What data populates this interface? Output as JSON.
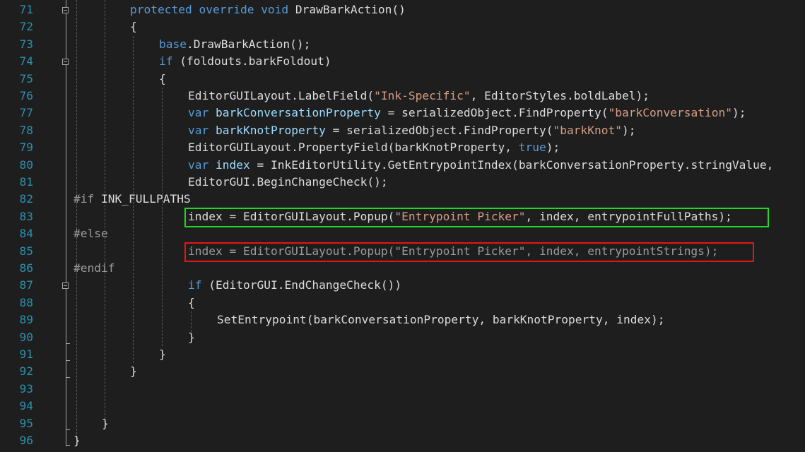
{
  "editor": {
    "line_numbers": [
      "71",
      "72",
      "73",
      "74",
      "75",
      "76",
      "77",
      "78",
      "79",
      "80",
      "81",
      "82",
      "83",
      "84",
      "85",
      "86",
      "87",
      "88",
      "89",
      "90",
      "91",
      "92",
      "93",
      "94",
      "95",
      "96"
    ],
    "lines": [
      {
        "indent": 80,
        "tokens": [
          {
            "t": "protected",
            "c": "kw"
          },
          {
            "t": " "
          },
          {
            "t": "override",
            "c": "kw"
          },
          {
            "t": " "
          },
          {
            "t": "void",
            "c": "kw"
          },
          {
            "t": " DrawBarkAction()"
          }
        ]
      },
      {
        "indent": 80,
        "tokens": [
          {
            "t": "{"
          }
        ]
      },
      {
        "indent": 121,
        "tokens": [
          {
            "t": "base",
            "c": "kw"
          },
          {
            "t": ".DrawBarkAction();"
          }
        ]
      },
      {
        "indent": 121,
        "tokens": [
          {
            "t": "if",
            "c": "kw"
          },
          {
            "t": " (foldouts.barkFoldout)"
          }
        ]
      },
      {
        "indent": 121,
        "tokens": [
          {
            "t": "{"
          }
        ]
      },
      {
        "indent": 162,
        "tokens": [
          {
            "t": "EditorGUILayout.LabelField("
          },
          {
            "t": "\"Ink-Specific\"",
            "c": "str"
          },
          {
            "t": ", EditorStyles.boldLabel);"
          }
        ]
      },
      {
        "indent": 162,
        "tokens": [
          {
            "t": "var",
            "c": "kw"
          },
          {
            "t": " "
          },
          {
            "t": "barkConversationProperty",
            "c": "var"
          },
          {
            "t": " = serializedObject.FindProperty("
          },
          {
            "t": "\"barkConversation\"",
            "c": "str"
          },
          {
            "t": ");"
          }
        ]
      },
      {
        "indent": 162,
        "tokens": [
          {
            "t": "var",
            "c": "kw"
          },
          {
            "t": " "
          },
          {
            "t": "barkKnotProperty",
            "c": "var"
          },
          {
            "t": " = serializedObject.FindProperty("
          },
          {
            "t": "\"barkKnot\"",
            "c": "str"
          },
          {
            "t": ");"
          }
        ]
      },
      {
        "indent": 162,
        "tokens": [
          {
            "t": "EditorGUILayout.PropertyField(barkKnotProperty, "
          },
          {
            "t": "true",
            "c": "kw"
          },
          {
            "t": ");"
          }
        ]
      },
      {
        "indent": 162,
        "tokens": [
          {
            "t": "var",
            "c": "kw"
          },
          {
            "t": " "
          },
          {
            "t": "index",
            "c": "var"
          },
          {
            "t": " = InkEditorUtility.GetEntrypointIndex(barkConversationProperty.stringValue,"
          }
        ]
      },
      {
        "indent": 162,
        "tokens": [
          {
            "t": "EditorGUI.BeginChangeCheck();"
          }
        ]
      },
      {
        "indent": 0,
        "tokens": [
          {
            "t": "#if",
            "c": "pp"
          },
          {
            "t": " INK_FULLPATHS"
          }
        ]
      },
      {
        "indent": 162,
        "tokens": [
          {
            "t": "index = EditorGUILayout.Popup("
          },
          {
            "t": "\"Entrypoint Picker\"",
            "c": "str"
          },
          {
            "t": ", index, entrypointFullPaths);"
          }
        ]
      },
      {
        "indent": 0,
        "tokens": [
          {
            "t": "#else",
            "c": "pp"
          }
        ]
      },
      {
        "indent": 162,
        "tokens": [
          {
            "t": "index = EditorGUILayout.Popup(\"Entrypoint Picker\", index, entrypointStrings);",
            "c": "dim"
          }
        ]
      },
      {
        "indent": 0,
        "tokens": [
          {
            "t": "#endif",
            "c": "pp"
          }
        ]
      },
      {
        "indent": 162,
        "tokens": [
          {
            "t": "if",
            "c": "kw"
          },
          {
            "t": " (EditorGUI.EndChangeCheck())"
          }
        ]
      },
      {
        "indent": 162,
        "tokens": [
          {
            "t": "{"
          }
        ]
      },
      {
        "indent": 203,
        "tokens": [
          {
            "t": "SetEntrypoint(barkConversationProperty, barkKnotProperty, index);"
          }
        ]
      },
      {
        "indent": 162,
        "tokens": [
          {
            "t": "}"
          }
        ]
      },
      {
        "indent": 121,
        "tokens": [
          {
            "t": "}"
          }
        ]
      },
      {
        "indent": 80,
        "tokens": [
          {
            "t": "}"
          }
        ]
      },
      {
        "indent": 0,
        "tokens": []
      },
      {
        "indent": 0,
        "tokens": []
      },
      {
        "indent": 40,
        "tokens": [
          {
            "t": "}"
          }
        ]
      },
      {
        "indent": 0,
        "tokens": [
          {
            "t": "}"
          }
        ]
      }
    ],
    "highlights": [
      {
        "name": "green-highlight-box",
        "line": 12,
        "color": "#22d622"
      },
      {
        "name": "red-highlight-box",
        "line": 14,
        "color": "#e81414"
      }
    ]
  }
}
